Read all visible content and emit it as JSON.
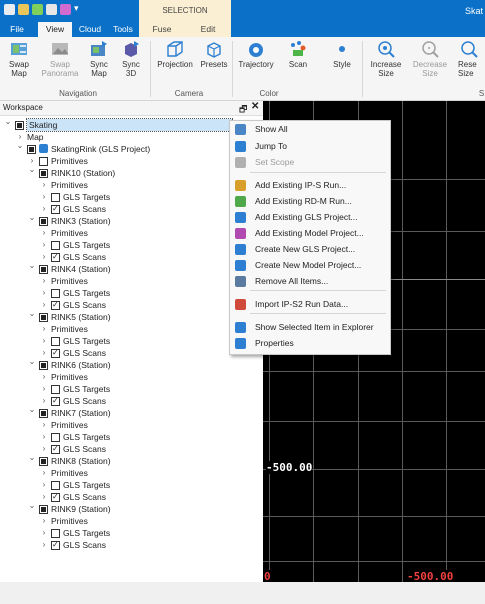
{
  "window": {
    "title": "Skat",
    "context_group": "SELECTION"
  },
  "tabs": [
    {
      "label": "File"
    },
    {
      "label": "View"
    },
    {
      "label": "Cloud"
    },
    {
      "label": "Tools"
    },
    {
      "label": "Fuse"
    },
    {
      "label": "Edit"
    }
  ],
  "ribbon": {
    "swap_map": "Swap\nMap",
    "swap_panorama": "Swap\nPanorama",
    "sync_map": "Sync\nMap",
    "sync_3d": "Sync\n3D",
    "projection": "Projection",
    "presets": "Presets",
    "trajectory": "Trajectory",
    "scan": "Scan",
    "style": "Style",
    "increase_size": "Increase\nSize",
    "decrease_size": "Decrease\nSize",
    "reset_size": "Rese\nSize",
    "groups": {
      "navigation": "Navigation",
      "camera": "Camera",
      "color": "Color",
      "size": "S"
    }
  },
  "workspace": {
    "title": "Workspace",
    "tree": [
      {
        "label": "Skating",
        "indent": 0,
        "exp": "v",
        "cb": "fill",
        "selected": true
      },
      {
        "label": "Map",
        "indent": 1,
        "exp": ">",
        "cb": "none"
      },
      {
        "label": "SkatingRink (GLS Project)",
        "indent": 1,
        "exp": "v",
        "cb": "fill",
        "icon": "gls"
      },
      {
        "label": "Primitives",
        "indent": 2,
        "exp": ">",
        "cb": "empty"
      },
      {
        "label": "RINK10 (Station)",
        "indent": 2,
        "exp": "v",
        "cb": "fill"
      },
      {
        "label": "Primitives",
        "indent": 3,
        "exp": ">",
        "cb": "none"
      },
      {
        "label": "GLS Targets",
        "indent": 3,
        "exp": ">",
        "cb": "empty"
      },
      {
        "label": "GLS Scans",
        "indent": 3,
        "exp": ">",
        "cb": "chk"
      },
      {
        "label": "RINK3 (Station)",
        "indent": 2,
        "exp": "v",
        "cb": "fill"
      },
      {
        "label": "Primitives",
        "indent": 3,
        "exp": ">",
        "cb": "none"
      },
      {
        "label": "GLS Targets",
        "indent": 3,
        "exp": ">",
        "cb": "empty"
      },
      {
        "label": "GLS Scans",
        "indent": 3,
        "exp": ">",
        "cb": "chk"
      },
      {
        "label": "RINK4 (Station)",
        "indent": 2,
        "exp": "v",
        "cb": "fill"
      },
      {
        "label": "Primitives",
        "indent": 3,
        "exp": ">",
        "cb": "none"
      },
      {
        "label": "GLS Targets",
        "indent": 3,
        "exp": ">",
        "cb": "empty"
      },
      {
        "label": "GLS Scans",
        "indent": 3,
        "exp": ">",
        "cb": "chk"
      },
      {
        "label": "RINK5 (Station)",
        "indent": 2,
        "exp": "v",
        "cb": "fill"
      },
      {
        "label": "Primitives",
        "indent": 3,
        "exp": ">",
        "cb": "none"
      },
      {
        "label": "GLS Targets",
        "indent": 3,
        "exp": ">",
        "cb": "empty"
      },
      {
        "label": "GLS Scans",
        "indent": 3,
        "exp": ">",
        "cb": "chk"
      },
      {
        "label": "RINK6 (Station)",
        "indent": 2,
        "exp": "v",
        "cb": "fill"
      },
      {
        "label": "Primitives",
        "indent": 3,
        "exp": ">",
        "cb": "none"
      },
      {
        "label": "GLS Targets",
        "indent": 3,
        "exp": ">",
        "cb": "empty"
      },
      {
        "label": "GLS Scans",
        "indent": 3,
        "exp": ">",
        "cb": "chk"
      },
      {
        "label": "RINK7 (Station)",
        "indent": 2,
        "exp": "v",
        "cb": "fill"
      },
      {
        "label": "Primitives",
        "indent": 3,
        "exp": ">",
        "cb": "none"
      },
      {
        "label": "GLS Targets",
        "indent": 3,
        "exp": ">",
        "cb": "empty"
      },
      {
        "label": "GLS Scans",
        "indent": 3,
        "exp": ">",
        "cb": "chk"
      },
      {
        "label": "RINK8 (Station)",
        "indent": 2,
        "exp": "v",
        "cb": "fill"
      },
      {
        "label": "Primitives",
        "indent": 3,
        "exp": ">",
        "cb": "none"
      },
      {
        "label": "GLS Targets",
        "indent": 3,
        "exp": ">",
        "cb": "empty"
      },
      {
        "label": "GLS Scans",
        "indent": 3,
        "exp": ">",
        "cb": "chk"
      },
      {
        "label": "RINK9 (Station)",
        "indent": 2,
        "exp": "v",
        "cb": "fill"
      },
      {
        "label": "Primitives",
        "indent": 3,
        "exp": ">",
        "cb": "none"
      },
      {
        "label": "GLS Targets",
        "indent": 3,
        "exp": ">",
        "cb": "empty"
      },
      {
        "label": "GLS Scans",
        "indent": 3,
        "exp": ">",
        "cb": "chk"
      }
    ]
  },
  "viewport": {
    "label_mid": "-500.00",
    "label_bottom_left": "0",
    "label_bottom_right": "-500.00"
  },
  "context_menu": {
    "items": [
      {
        "label": "Show All",
        "icon": "show-all-icon",
        "enabled": true
      },
      {
        "label": "Jump To",
        "icon": "jump-to-icon",
        "enabled": true
      },
      {
        "label": "Set Scope",
        "icon": "set-scope-icon",
        "enabled": false
      },
      {
        "label": "Add Existing IP-S Run...",
        "icon": "ips-run-icon",
        "enabled": true
      },
      {
        "label": "Add Existing RD-M Run...",
        "icon": "rdm-run-icon",
        "enabled": true
      },
      {
        "label": "Add Existing GLS Project...",
        "icon": "gls-project-icon",
        "enabled": true
      },
      {
        "label": "Add Existing Model Project...",
        "icon": "model-project-icon",
        "enabled": true
      },
      {
        "label": "Create New GLS Project...",
        "icon": "new-gls-project-icon",
        "enabled": true
      },
      {
        "label": "Create New Model Project...",
        "icon": "new-model-project-icon",
        "enabled": true
      },
      {
        "label": "Remove All Items...",
        "icon": "remove-all-icon",
        "enabled": true
      },
      {
        "label": "Import IP-S2 Run Data...",
        "icon": "import-ips2-icon",
        "enabled": true
      },
      {
        "label": "Show Selected Item in Explorer",
        "icon": "explorer-icon",
        "enabled": true
      },
      {
        "label": "Properties",
        "icon": "properties-icon",
        "enabled": true
      }
    ]
  },
  "colors": {
    "title_bar": "#0a70c8",
    "context_tab": "#fbefd3",
    "selection": "#cce4f7",
    "viewport_bg": "#000000"
  }
}
